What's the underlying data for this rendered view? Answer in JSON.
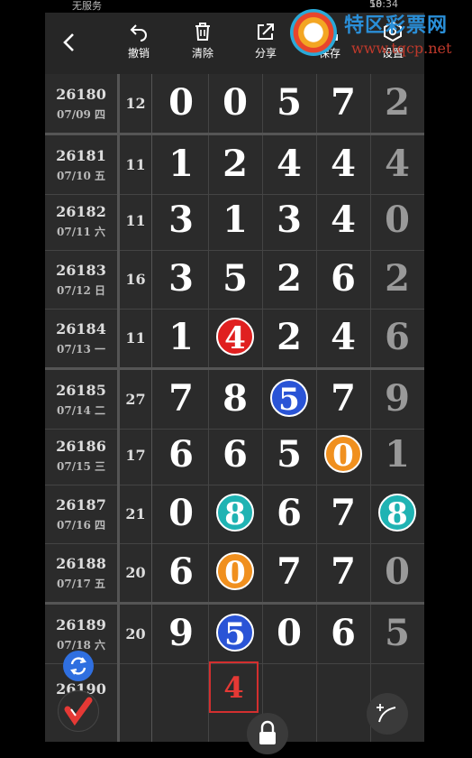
{
  "status_bar": {
    "carrier": "无服务",
    "battery": "58",
    "time": "10:34"
  },
  "toolbar": {
    "back_icon": "chevron-left-icon",
    "items": [
      {
        "label": "撤销",
        "icon": "undo-icon"
      },
      {
        "label": "清除",
        "icon": "trash-icon"
      },
      {
        "label": "分享",
        "icon": "share-icon"
      },
      {
        "label": "保存",
        "icon": "save-icon"
      },
      {
        "label": "设置",
        "icon": "settings-icon"
      }
    ]
  },
  "watermark": {
    "title": "特区彩票网",
    "url": "www.tqcp.net"
  },
  "rows": [
    {
      "issue": "26180",
      "date": "07/09 四",
      "sum": "12",
      "digits": [
        "0",
        "0",
        "5",
        "7"
      ],
      "last": "2",
      "balls": []
    },
    {
      "issue": "26181",
      "date": "07/10 五",
      "sum": "11",
      "digits": [
        "1",
        "2",
        "4",
        "4"
      ],
      "last": "4",
      "balls": []
    },
    {
      "issue": "26182",
      "date": "07/11 六",
      "sum": "11",
      "digits": [
        "3",
        "1",
        "3",
        "4"
      ],
      "last": "0",
      "balls": []
    },
    {
      "issue": "26183",
      "date": "07/12 日",
      "sum": "16",
      "digits": [
        "3",
        "5",
        "2",
        "6"
      ],
      "last": "2",
      "balls": []
    },
    {
      "issue": "26184",
      "date": "07/13 一",
      "sum": "11",
      "digits": [
        "1",
        "4",
        "2",
        "4"
      ],
      "last": "6",
      "balls": [
        {
          "col": 1,
          "color": "#e02020"
        }
      ]
    },
    {
      "issue": "26185",
      "date": "07/14 二",
      "sum": "27",
      "digits": [
        "7",
        "8",
        "5",
        "7"
      ],
      "last": "9",
      "balls": [
        {
          "col": 2,
          "color": "#2a54d6"
        }
      ]
    },
    {
      "issue": "26186",
      "date": "07/15 三",
      "sum": "17",
      "digits": [
        "6",
        "6",
        "5",
        "0"
      ],
      "last": "1",
      "balls": [
        {
          "col": 3,
          "color": "#f0901f"
        }
      ]
    },
    {
      "issue": "26187",
      "date": "07/16 四",
      "sum": "21",
      "digits": [
        "0",
        "8",
        "6",
        "7"
      ],
      "last": "8",
      "balls": [
        {
          "col": 1,
          "color": "#1fb3b3"
        },
        {
          "col": 4,
          "color": "#1fb3b3"
        }
      ]
    },
    {
      "issue": "26188",
      "date": "07/17 五",
      "sum": "20",
      "digits": [
        "6",
        "0",
        "7",
        "7"
      ],
      "last": "0",
      "balls": [
        {
          "col": 1,
          "color": "#f0901f"
        }
      ]
    },
    {
      "issue": "26189",
      "date": "07/18 六",
      "sum": "20",
      "digits": [
        "9",
        "5",
        "0",
        "6"
      ],
      "last": "5",
      "balls": [
        {
          "col": 1,
          "color": "#2a54d6"
        }
      ]
    }
  ],
  "next_issue": "26190",
  "prediction": "4",
  "fab": {
    "refresh_icon": "refresh-icon",
    "logo_icon": "app-logo-icon",
    "pen_icon": "pen-icon",
    "lock_icon": "lock-icon"
  }
}
